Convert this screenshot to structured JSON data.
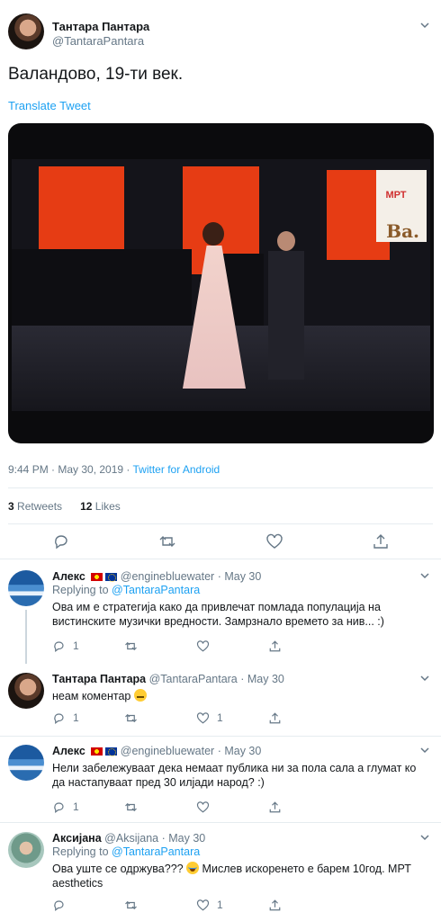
{
  "tweet": {
    "author_name": "Тантара Пантара",
    "author_handle": "@TantaraPantara",
    "text": "Валандово, 19-ти век.",
    "translate_label": "Translate Tweet",
    "media": {
      "overlay_text": "Ва.",
      "logo_text": "МРТ"
    },
    "timestamp": "9:44 PM · May 30, 2019 · ",
    "source": "Twitter for Android",
    "retweets_count": "3",
    "retweets_label": "Retweets",
    "likes_count": "12",
    "likes_label": "Likes",
    "actions": {
      "reply_icon": "reply-icon",
      "retweet_icon": "retweet-icon",
      "like_icon": "like-icon",
      "share_icon": "share-icon"
    }
  },
  "replies": [
    {
      "name": "Алекс",
      "flags": [
        "mk-flag",
        "eu-flag"
      ],
      "handle": "@enginebluewater",
      "date": "· May 30",
      "replying_prefix": "Replying to ",
      "replying_to": "@TantaraPantara",
      "text": "Ова им е стратегија како да привлечат помлада популација на вистинските музички вредности. Замрзнало времето за нив... :)",
      "reply_count": "1",
      "retweet_count": "",
      "like_count": ""
    },
    {
      "name": "Тантара Пантара",
      "handle": "@TantaraPantara",
      "date": "· May 30",
      "text": "неам коментар",
      "reply_count": "1",
      "retweet_count": "",
      "like_count": "1"
    },
    {
      "name": "Алекс",
      "flags": [
        "mk-flag",
        "eu-flag"
      ],
      "handle": "@enginebluewater",
      "date": "· May 30",
      "text": "Нели забележуваат дека немаат публика ни за пола сала а глумат ко да настапуваат пред 30 илјади народ? :)",
      "reply_count": "1",
      "retweet_count": "",
      "like_count": ""
    },
    {
      "name": "Аксијана",
      "handle": "@Aksijana",
      "date": "· May 30",
      "replying_prefix": "Replying to ",
      "replying_to": "@TantaraPantara",
      "text_before_emoji": "Ова уште се одржува??? ",
      "text_after_emoji": " Мислев искоренето е барем 10год. МРТ aesthetics",
      "reply_count": "",
      "retweet_count": "",
      "like_count": "1"
    }
  ],
  "colors": {
    "link": "#1da1f2",
    "muted": "#657786",
    "divider": "#e6ecf0"
  }
}
